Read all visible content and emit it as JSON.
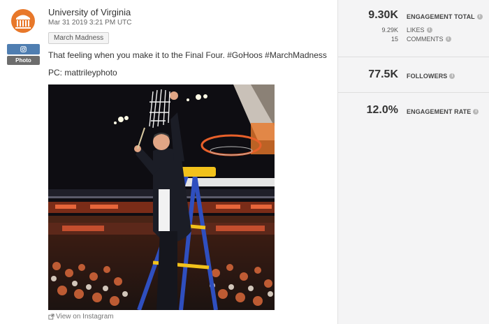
{
  "post": {
    "author": "University of Virginia",
    "date": "Mar 31 2019 3:21 PM UTC",
    "tag": "March Madness",
    "caption": "That feeling when you make it to the Final Four. #GoHoos #MarchMadness",
    "credit": "PC: mattrileyphoto",
    "network_icon": "instagram-icon",
    "type_label": "Photo",
    "view_link": "View on Instagram",
    "photo_description_icon": "photo-image"
  },
  "stats": {
    "engagement_total_value": "9.30K",
    "engagement_total_label": "ENGAGEMENT TOTAL",
    "likes_value": "9.29K",
    "likes_label": "LIKES",
    "comments_value": "15",
    "comments_label": "COMMENTS",
    "followers_value": "77.5K",
    "followers_label": "FOLLOWERS",
    "engagement_rate_value": "12.0%",
    "engagement_rate_label": "ENGAGEMENT RATE"
  },
  "colors": {
    "brand_orange": "#e8782a",
    "network_blue": "#4f7eb1",
    "panel_bg": "#f4f4f5"
  }
}
